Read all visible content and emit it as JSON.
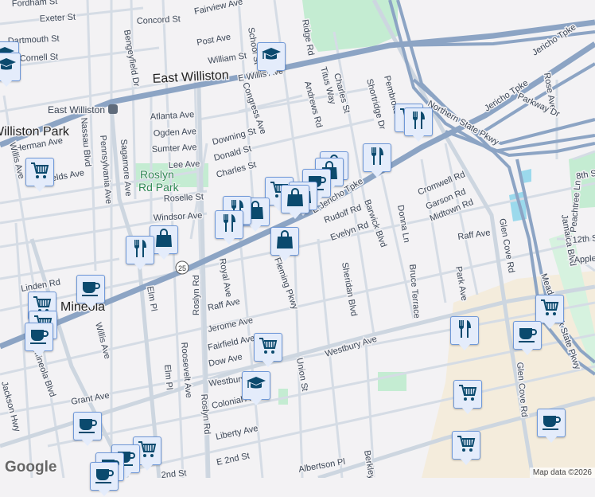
{
  "map": {
    "attribution": "Map data ©2026",
    "logo": "Google",
    "route_shield": "25",
    "transit_station": "East Williston",
    "colors": {
      "background": "#f3f2f4",
      "highway": "#8ca4c4",
      "park": "#c4ecd2",
      "marker_fill": "#e4ecfb",
      "marker_icon": "#0b4a6e"
    }
  },
  "labels": {
    "fordham": "Fordham St",
    "exeter": "Exeter St",
    "dartmouth": "Dartmouth St",
    "cornell": "Cornell St",
    "concord": "Concord St",
    "fairview": "Fairview Ave",
    "post": "Post Ave",
    "william": "William St",
    "school": "School St",
    "ewilliston": "East Williston",
    "ewillisave": "E Willis Ave",
    "bengeyfield": "Bengeyfield Dr",
    "atlanta": "Atlanta Ave",
    "ogden": "Ogden Ave",
    "sumter": "Sumter Ave",
    "lee": "Lee Ave",
    "roselle": "Roselle St",
    "windsor": "Windsor Ave",
    "downing": "Downing St",
    "donald": "Donald St",
    "charles": "Charles St",
    "congress": "Congress Ave",
    "wpark": "Williston Park",
    "herman": "Herman Ave",
    "shields": "Shields Ave",
    "nassau": "Nassau Blvd",
    "penn": "Pennsylvania Ave",
    "sagamore": "Sagamore Ave",
    "willis": "Willis Ave",
    "roslynpark": "Roslyn Rd Park",
    "ridge": "Ridge Rd",
    "titus": "Titus Way",
    "andrews": "Andrews Rd",
    "charles2": "Charles St",
    "shortridge": "Shortridge Dr",
    "pembroke": "Pembroke",
    "northern": "Northern State Pkwy",
    "jericho1": "Jericho Tpke",
    "jericho2": "Jericho Tpke",
    "rose": "Rose Ave",
    "parkway": "Parkway Dr",
    "ejericho": "E Jericho Tpke",
    "rudolf": "Rudolf Rd",
    "evelyn": "Evelyn Rd",
    "barwick": "Barwick Blvd",
    "donna": "Donna Ln",
    "cromwell": "Cromwell Rd",
    "garson": "Garson Rd",
    "midtown": "Midtown Rd",
    "raff": "Raff Ave",
    "raff2": "Raff Ave",
    "eighth": "8th St",
    "peachtree": "Peachtree Ln",
    "jamaica": "Jamaica Blvd",
    "twelfth": "12th St",
    "apple": "Apple",
    "linden": "Linden Rd",
    "mineola": "Mineola",
    "elm": "Elm Pl",
    "elm2": "Elm Pl",
    "roslynrd": "Roslyn Rd",
    "roslynrd2": "Roslyn Rd",
    "royal": "Royal Ave",
    "flemingpkwy": "Fleming Pkwy",
    "jerome": "Jerome Ave",
    "fairfield": "Fairfield Ave",
    "dow": "Dow Ave",
    "westbury": "Westbury Ave",
    "westbury2": "Westbury Ave",
    "colonial": "Colonial Ave",
    "roosevelt": "Roosevelt Ave",
    "union": "Union St",
    "grant": "Grant Ave",
    "liberty": "Liberty Ave",
    "e2nd": "E 2nd St",
    "2nd": "2nd St",
    "albertson": "Albertson Pl",
    "berkley": "Berkley",
    "willis2": "Willis Ave",
    "mineolablvd": "Mineola Blvd",
    "sheridan": "Sheridan Blvd",
    "bruce": "Bruce Terrace",
    "parkave": "Park Ave",
    "glencove": "Glen Cove Rd",
    "glencove2": "Glen Cove Rd",
    "meadowbrook": "Meadowbrook State Pkwy",
    "jacksonhwy": "Jackson Hwy"
  },
  "markers": [
    {
      "type": "school"
    },
    {
      "type": "school"
    },
    {
      "type": "school"
    },
    {
      "type": "cart"
    },
    {
      "type": "cart"
    },
    {
      "type": "fork"
    },
    {
      "type": "fork"
    },
    {
      "type": "bag"
    },
    {
      "type": "bag"
    },
    {
      "type": "cart"
    },
    {
      "type": "coffee"
    },
    {
      "type": "bag"
    },
    {
      "type": "bag"
    },
    {
      "type": "bag"
    },
    {
      "type": "fork"
    },
    {
      "type": "fork"
    },
    {
      "type": "bag"
    },
    {
      "type": "fork"
    },
    {
      "type": "bag"
    },
    {
      "type": "coffee"
    },
    {
      "type": "cart"
    },
    {
      "type": "cart"
    },
    {
      "type": "coffee"
    },
    {
      "type": "cart"
    },
    {
      "type": "school"
    },
    {
      "type": "fork"
    },
    {
      "type": "cart"
    },
    {
      "type": "coffee"
    },
    {
      "type": "cart"
    },
    {
      "type": "cart"
    },
    {
      "type": "coffee"
    },
    {
      "type": "coffee"
    },
    {
      "type": "cart"
    },
    {
      "type": "coffee"
    },
    {
      "type": "coffee"
    },
    {
      "type": "coffee"
    }
  ]
}
